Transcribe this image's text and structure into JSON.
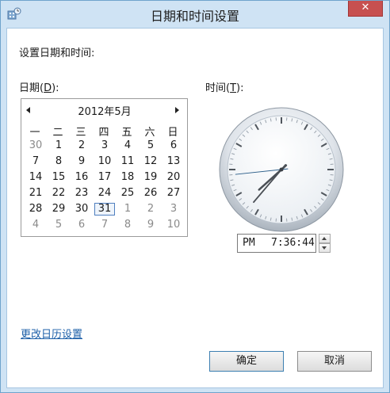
{
  "window": {
    "title": "日期和时间设置",
    "close_glyph": "✕"
  },
  "heading": "设置日期和时间:",
  "date_label": {
    "text": "日期(",
    "key": "D",
    "suffix": "):"
  },
  "time_label": {
    "text": "时间(",
    "key": "T",
    "suffix": "):"
  },
  "calendar": {
    "month_title": "2012年5月",
    "weekdays": [
      "一",
      "二",
      "三",
      "四",
      "五",
      "六",
      "日"
    ],
    "weeks": [
      [
        {
          "d": "30",
          "other": true
        },
        {
          "d": "1"
        },
        {
          "d": "2"
        },
        {
          "d": "3"
        },
        {
          "d": "4"
        },
        {
          "d": "5"
        },
        {
          "d": "6"
        }
      ],
      [
        {
          "d": "7"
        },
        {
          "d": "8"
        },
        {
          "d": "9"
        },
        {
          "d": "10"
        },
        {
          "d": "11"
        },
        {
          "d": "12"
        },
        {
          "d": "13"
        }
      ],
      [
        {
          "d": "14"
        },
        {
          "d": "15"
        },
        {
          "d": "16"
        },
        {
          "d": "17"
        },
        {
          "d": "18"
        },
        {
          "d": "19"
        },
        {
          "d": "20"
        }
      ],
      [
        {
          "d": "21"
        },
        {
          "d": "22"
        },
        {
          "d": "23"
        },
        {
          "d": "24"
        },
        {
          "d": "25"
        },
        {
          "d": "26"
        },
        {
          "d": "27"
        }
      ],
      [
        {
          "d": "28"
        },
        {
          "d": "29"
        },
        {
          "d": "30"
        },
        {
          "d": "31",
          "selected": true
        },
        {
          "d": "1",
          "other": true
        },
        {
          "d": "2",
          "other": true
        },
        {
          "d": "3",
          "other": true
        }
      ],
      [
        {
          "d": "4",
          "other": true
        },
        {
          "d": "5",
          "other": true
        },
        {
          "d": "6",
          "other": true
        },
        {
          "d": "7",
          "other": true
        },
        {
          "d": "8",
          "other": true
        },
        {
          "d": "9",
          "other": true
        },
        {
          "d": "10",
          "other": true
        }
      ]
    ]
  },
  "clock": {
    "hour": 7,
    "minute": 36,
    "second": 44
  },
  "time_field": {
    "ampm": "PM",
    "value": "7:36:44"
  },
  "change_calendar_link": "更改日历设置",
  "buttons": {
    "ok": "确定",
    "cancel": "取消"
  },
  "colors": {
    "titlebar": "#cfe3f4",
    "close": "#c75050",
    "link": "#1c5fa8",
    "selection": "#4f7fbf"
  }
}
